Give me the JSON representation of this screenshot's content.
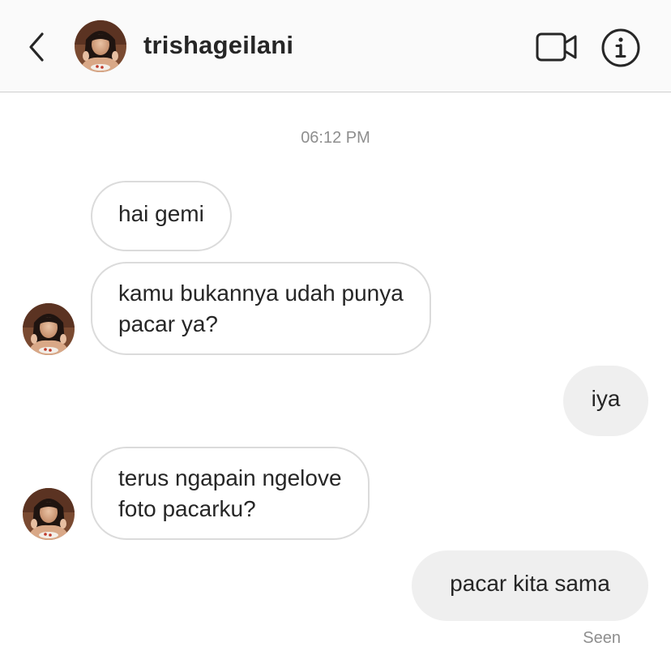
{
  "header": {
    "username": "trishageilani",
    "back_icon": "chevron-left-icon",
    "video_icon": "video-camera-icon",
    "info_icon": "info-circle-icon"
  },
  "thread": {
    "timestamp": "06:12 PM",
    "messages": [
      {
        "from": "them",
        "lines": [
          "hai gemi"
        ]
      },
      {
        "from": "them",
        "lines": [
          "kamu bukannya udah punya",
          "pacar ya?"
        ]
      },
      {
        "from": "me",
        "lines": [
          "iya"
        ]
      },
      {
        "from": "them",
        "lines": [
          "terus ngapain ngelove",
          "foto pacarku?"
        ]
      },
      {
        "from": "me",
        "lines": [
          "pacar kita sama"
        ]
      }
    ],
    "status": "Seen"
  },
  "colors": {
    "header_bg": "#fafafa",
    "incoming_border": "#dbdbdb",
    "outgoing_bg": "#efefef",
    "muted_text": "#8e8e8e"
  }
}
